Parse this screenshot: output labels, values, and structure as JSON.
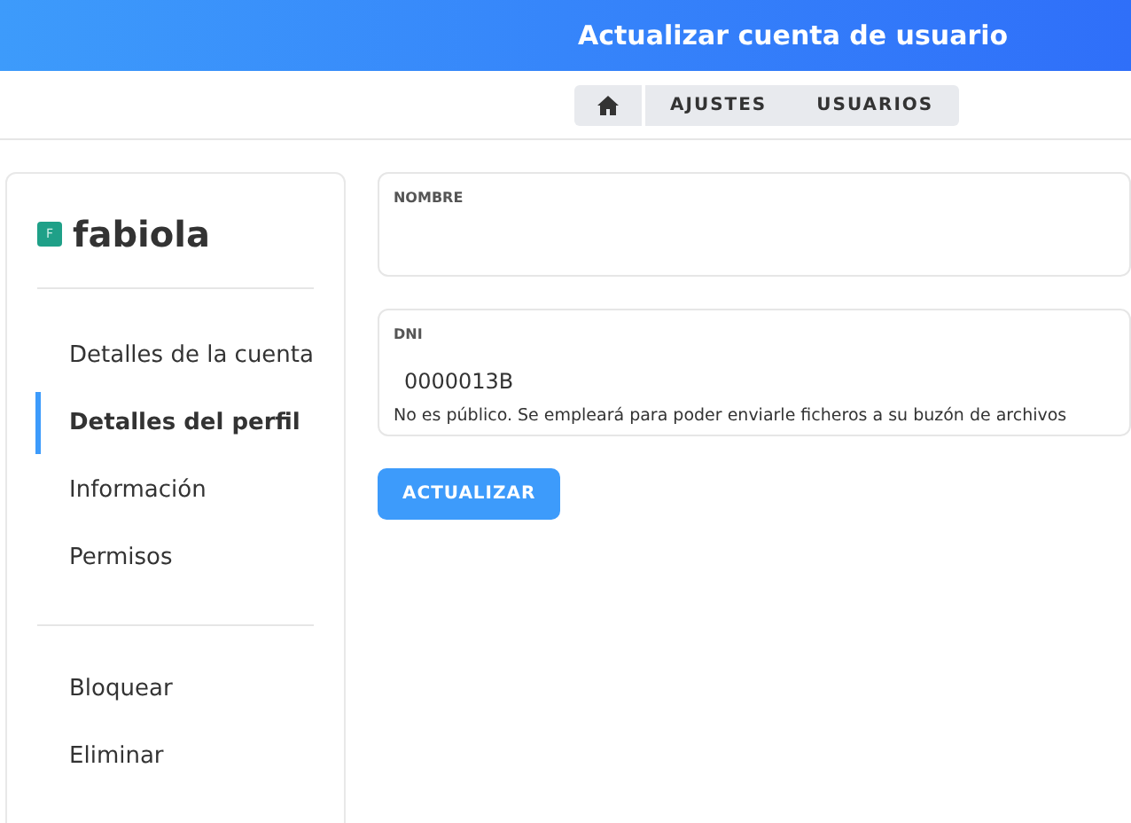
{
  "header": {
    "title": "Actualizar cuenta de usuario"
  },
  "breadcrumb": [
    {
      "kind": "home"
    },
    {
      "kind": "text",
      "label": "AJUSTES"
    },
    {
      "kind": "text",
      "label": "USUARIOS"
    }
  ],
  "sidebar": {
    "user": {
      "initial": "F",
      "name": "fabiola"
    },
    "nav": [
      {
        "label": "Detalles de la cuenta",
        "selected": false
      },
      {
        "label": "Detalles del perfil",
        "selected": true
      },
      {
        "label": "Información",
        "selected": false
      },
      {
        "label": "Permisos",
        "selected": false
      }
    ],
    "actions": [
      {
        "label": "Bloquear"
      },
      {
        "label": "Eliminar"
      }
    ]
  },
  "form": {
    "fields": [
      {
        "label": "NOMBRE"
      },
      {
        "label": "DNI",
        "value": "0000013B",
        "help": "No es público. Se empleará para poder enviarle ficheros a su buzón de archivos"
      }
    ],
    "submit": "ACTUALIZAR"
  }
}
